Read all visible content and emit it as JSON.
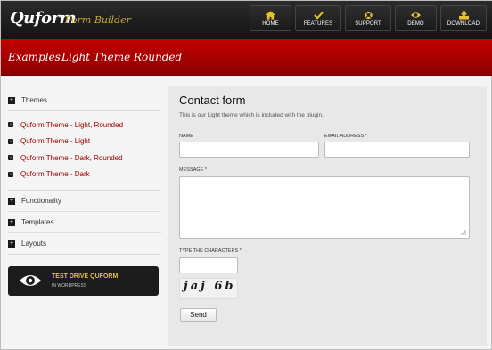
{
  "header": {
    "logo": "Quform",
    "logo_sub": "Form Builder",
    "nav": [
      {
        "label": "HOME",
        "icon": "home-icon"
      },
      {
        "label": "FEATURES",
        "icon": "checkmark-icon"
      },
      {
        "label": "SUPPORT",
        "icon": "lifebuoy-icon"
      },
      {
        "label": "DEMO",
        "icon": "eye-icon"
      },
      {
        "label": "DOWNLOAD",
        "icon": "download-icon"
      }
    ]
  },
  "breadcrumb": {
    "first": "Examples",
    "second": "Light Theme Rounded"
  },
  "sidebar": {
    "themes": {
      "label": "Themes",
      "items": [
        "Quform Theme - Light, Rounded",
        "Quform Theme - Light",
        "Quform Theme - Dark, Rounded",
        "Quform Theme - Dark"
      ]
    },
    "sections": [
      "Functionality",
      "Templates",
      "Layouts"
    ],
    "expand_symbol": "+",
    "bullet_symbol": "›",
    "testdrive": {
      "title": "TEST DRIVE QUFORM",
      "subtitle": "IN WORDPRESS"
    }
  },
  "form": {
    "title": "Contact form",
    "description": "This is our Light theme which is included with the plugin.",
    "name_label": "NAME",
    "email_label": "EMAIL ADDRESS *",
    "message_label": "MESSAGE *",
    "captcha_label": "TYPE THE CHARACTERS *",
    "captcha_text": "jaj 6b",
    "send_label": "Send"
  },
  "colors": {
    "accent_red": "#a10000",
    "testdrive_gold": "#e0c043",
    "nav_icon_gold": "#e8c22e"
  }
}
